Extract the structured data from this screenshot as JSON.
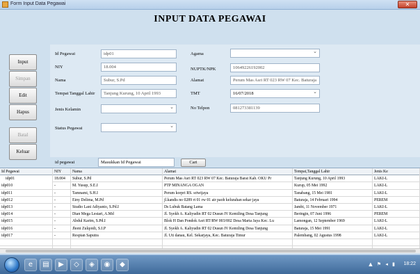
{
  "window": {
    "title": "Form Input Data Pegawai",
    "close_glyph": "✕"
  },
  "form_title": "INPUT DATA PEGAWAI",
  "buttons": {
    "input": "Input",
    "simpan": "Simpan",
    "edit": "Edit",
    "hapus": "Hapus",
    "batal": "Batal",
    "keluar": "Keluar",
    "cari": "Cari"
  },
  "fields": {
    "id_pegawai": {
      "label": "Id Pegawai",
      "value": "idp01"
    },
    "nip": {
      "label": "NIY",
      "value": "18.004"
    },
    "nama": {
      "label": "Nama",
      "value": "Subur, S.Pd"
    },
    "ttl": {
      "label": "Tempat Tanggal Lahir",
      "value": "Tanjung Kurung, 10 April 1993"
    },
    "jenis_kelamin": {
      "label": "Jenis Kelamin",
      "value": ""
    },
    "status": {
      "label": "Status Pegawai",
      "value": ""
    },
    "agama": {
      "label": "Agama",
      "value": ""
    },
    "nuptk": {
      "label": "NUPTK/NPK",
      "value": "10649226192002"
    },
    "alamat": {
      "label": "Alamat",
      "value": "Perum Mas Asri RT 023 RW 07 Kec. Baturaja"
    },
    "tmt": {
      "label": "TMT",
      "value": "16/07/2018"
    },
    "telpon": {
      "label": "No Telpon",
      "value": "081273381139"
    }
  },
  "search": {
    "label": "id pegawai",
    "placeholder": "Masukkan Id Pegawai"
  },
  "table": {
    "columns": [
      "Id Pegawai",
      "NIY",
      "Nama",
      "Alamat",
      "Tempat,Tanggal Lahir",
      "Jenis Ke"
    ],
    "selected_marker": "▶",
    "rows": [
      [
        "idp01",
        "18.004",
        "Subur, S.Pd",
        "Perum Mas Asri RT 023 RW 07 Kec. Baturaja Barat Kab. OKU Pr",
        "Tanjung Kurung, 10 April 1993",
        "LAKI-L"
      ],
      [
        "idp010",
        "-",
        "M. Yusup, S.E.I",
        "PTP MINANGA OGAN",
        "Kurup, 05 Mei 1992",
        "LAKI-L"
      ],
      [
        "idp011",
        "-",
        "Tamnami, S.H.I",
        "Perum korpri RS. sriwijaya",
        "Tanabang, 15 Mei 1981",
        "LAKI-L"
      ],
      [
        "idp012",
        "-",
        "Einy Delima, M.Pd",
        "jl.kandis no 0289 rt 01 rw 01 air paoh kelurahan sekar jaya",
        "Baturaja, 14 Februari 1994",
        "PEREM"
      ],
      [
        "idp013",
        "-",
        "Studio Lani Adiyanto, S.Pd.I",
        "Ds Lubuk Batang Lama",
        "Jambi, 11 November 1971",
        "LAKI-L"
      ],
      [
        "idp014",
        "-",
        "Dian Mega Lestari, A.Md",
        "Jl. Syekh A. Kaliyudin RT 02 Dusun IV Kemiling Desa Tanjung",
        "Beringin, 07 Juni 1996",
        "PEREM"
      ],
      [
        "idp015",
        "-",
        "Abdul Karim, S.Pd.I",
        "Blok H Dan Pondok Asri RT/RW 003/002 Desa Marta Jaya Kec. Lu",
        "Lamongan, 12 September 1969",
        "LAKI-L"
      ],
      [
        "idp016",
        "-",
        "Jhoni Zulqoidi, S.I.P",
        "Jl. Syekh A. Kaliyudin RT 02 Dusun IV Kemiling Desa Tanjung",
        "Baturaja, 15 Mei 1991",
        "LAKI-L"
      ],
      [
        "idp017",
        "-",
        "Respian Saputra",
        "Jl. Uti danau, Kel. Sekarjaya, Kec. Baturaja Timur",
        "Palembang, 02 Agustus 1998",
        "LAKI-L"
      ],
      [
        "",
        "",
        "",
        "",
        "",
        ""
      ],
      [
        "",
        "",
        "",
        "",
        "",
        ""
      ]
    ]
  },
  "taskbar": {
    "icons": [
      {
        "name": "ie-icon",
        "glyph": "e"
      },
      {
        "name": "folder-icon",
        "glyph": "▤"
      },
      {
        "name": "media-icon",
        "glyph": "▶"
      },
      {
        "name": "app-icon-1",
        "glyph": "◇"
      },
      {
        "name": "app-icon-2",
        "glyph": "◈"
      },
      {
        "name": "chrome-icon",
        "glyph": "◉"
      },
      {
        "name": "app-icon-3",
        "glyph": "◆"
      }
    ],
    "tray": "▲ ⚑ ◂ ▮",
    "clock": "18:22"
  }
}
